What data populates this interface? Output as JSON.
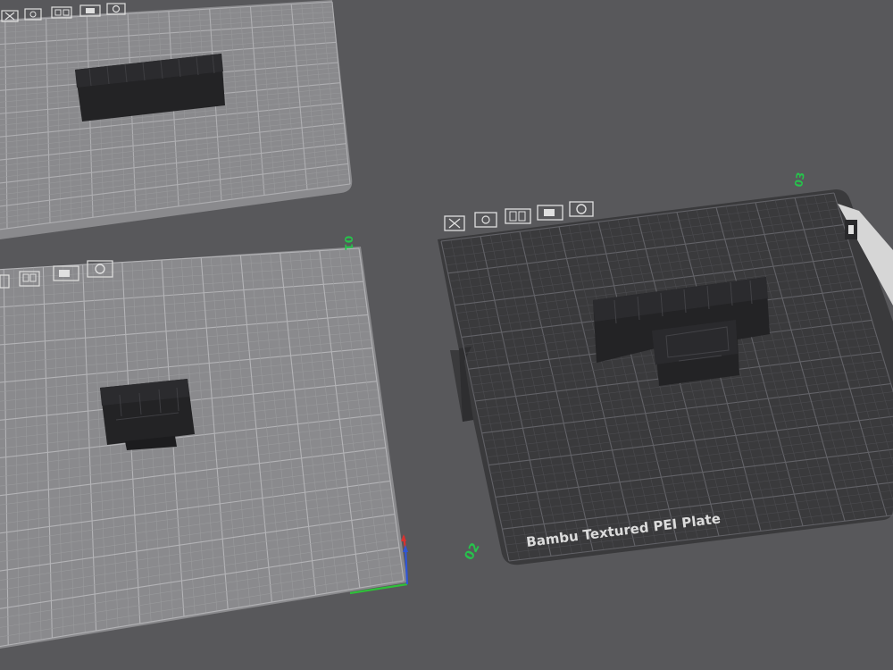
{
  "scene": {
    "background": "#58585b",
    "plates": [
      {
        "id": "plate-top-left",
        "number_label": "",
        "selected": false,
        "object": "wide-connector-housing",
        "icons": [
          "close-icon",
          "auto-orient-icon",
          "arrange-icon",
          "lock-icon",
          "settings-icon"
        ]
      },
      {
        "id": "plate-bottom-left",
        "number_label": "01",
        "selected": false,
        "object": "small-connector-housing",
        "icons": [
          "lock-icon",
          "arrange-icon",
          "auto-orient-icon",
          "settings-icon"
        ]
      },
      {
        "id": "plate-right",
        "number_label": "03",
        "selected": true,
        "object": "combined-connector-housings",
        "plate_type_label": "Bambu Textured PEI Plate",
        "icons": [
          "close-icon",
          "auto-orient-icon",
          "arrange-icon",
          "lock-icon",
          "settings-icon"
        ]
      }
    ],
    "floating_label": "02",
    "axes": {
      "x_color": "#2fbf3a",
      "y_color": "#2f56d8",
      "z_color": "#d8322f"
    },
    "colors": {
      "plate_light": "#8a8a8d",
      "plate_dark": "#3a3a3c",
      "grid_light": "#a4a4a7",
      "grid_dark": "#555558",
      "label_green": "#27c24c",
      "object": "#1f1f21"
    }
  }
}
